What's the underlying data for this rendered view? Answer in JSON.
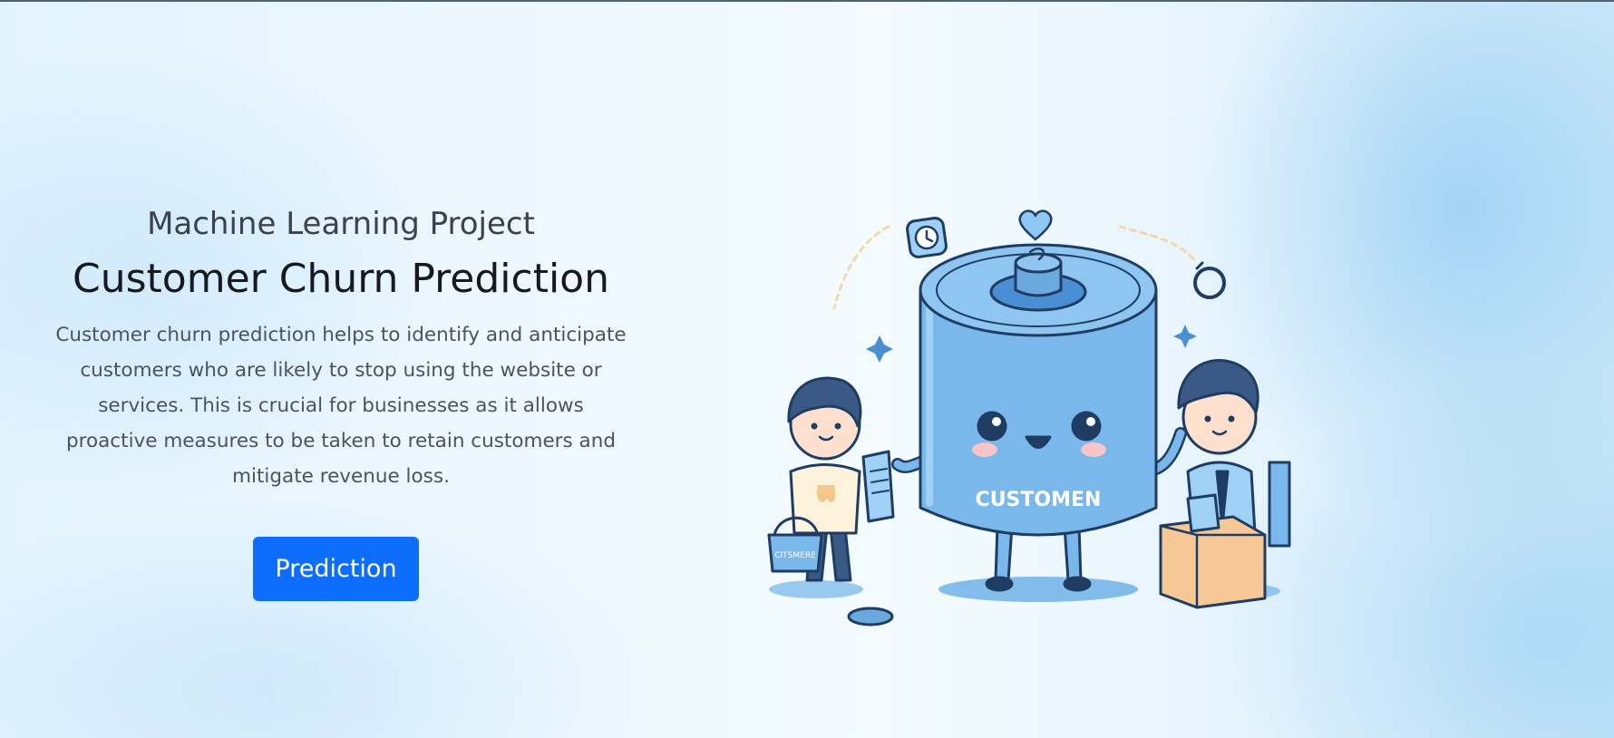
{
  "hero": {
    "subtitle": "Machine Learning Project",
    "title": "Customer Churn Prediction",
    "description": "Customer churn prediction helps to identify and anticipate customers who are likely to stop using the website or services. This is crucial for businesses as it allows proactive measures to be taken to retain customers and mitigate revenue loss.",
    "button_label": "Prediction"
  },
  "illustration": {
    "label": "CUSTOMEN",
    "basket_label": "CITSMERE"
  },
  "colors": {
    "button": "#0d6efd",
    "title": "#16191f",
    "subtitle": "#3a4150",
    "body_text": "#4b5360",
    "character_blue": "#7ab8ec"
  }
}
